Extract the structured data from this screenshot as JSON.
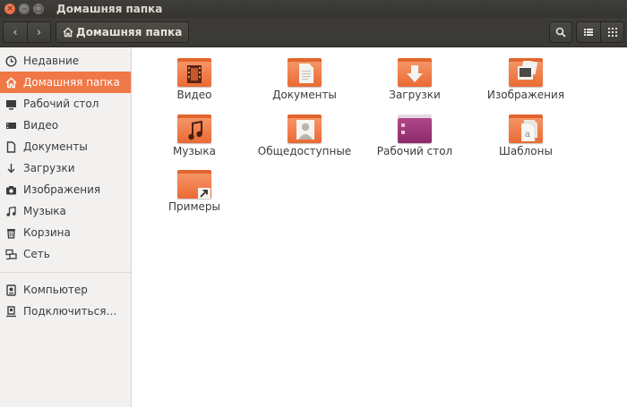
{
  "window": {
    "title": "Домашняя папка",
    "close_glyph": "×",
    "min_glyph": "–",
    "max_glyph": "□"
  },
  "toolbar": {
    "back_glyph": "‹",
    "forward_glyph": "›",
    "path_label": "Домашняя папка"
  },
  "sidebar": {
    "items": [
      {
        "label": "Недавние",
        "icon": "clock-icon"
      },
      {
        "label": "Домашняя папка",
        "icon": "home-icon",
        "active": true
      },
      {
        "label": "Рабочий стол",
        "icon": "desktop-icon"
      },
      {
        "label": "Видео",
        "icon": "video-icon"
      },
      {
        "label": "Документы",
        "icon": "document-icon"
      },
      {
        "label": "Загрузки",
        "icon": "download-icon"
      },
      {
        "label": "Изображения",
        "icon": "camera-icon"
      },
      {
        "label": "Музыка",
        "icon": "music-icon"
      },
      {
        "label": "Корзина",
        "icon": "trash-icon"
      },
      {
        "label": "Сеть",
        "icon": "network-icon"
      }
    ],
    "devices": [
      {
        "label": "Компьютер",
        "icon": "computer-icon"
      },
      {
        "label": "Подключиться…",
        "icon": "connect-icon"
      }
    ]
  },
  "files": [
    {
      "label": "Видео",
      "emblem": "film-icon"
    },
    {
      "label": "Документы",
      "emblem": "document-icon"
    },
    {
      "label": "Загрузки",
      "emblem": "download-arrow-icon"
    },
    {
      "label": "Изображения",
      "emblem": "picture-icon"
    },
    {
      "label": "Музыка",
      "emblem": "music-note-icon"
    },
    {
      "label": "Общедоступные",
      "emblem": "person-icon"
    },
    {
      "label": "Рабочий стол",
      "emblem": "desktop-icon"
    },
    {
      "label": "Шаблоны",
      "emblem": "template-icon"
    },
    {
      "label": "Примеры",
      "emblem": "link-arrow-icon"
    }
  ],
  "colors": {
    "accent": "#f07746",
    "folder": "#ea6a33",
    "desktop_folder": "#8d2a6c",
    "titlebar": "#3c3b37"
  }
}
